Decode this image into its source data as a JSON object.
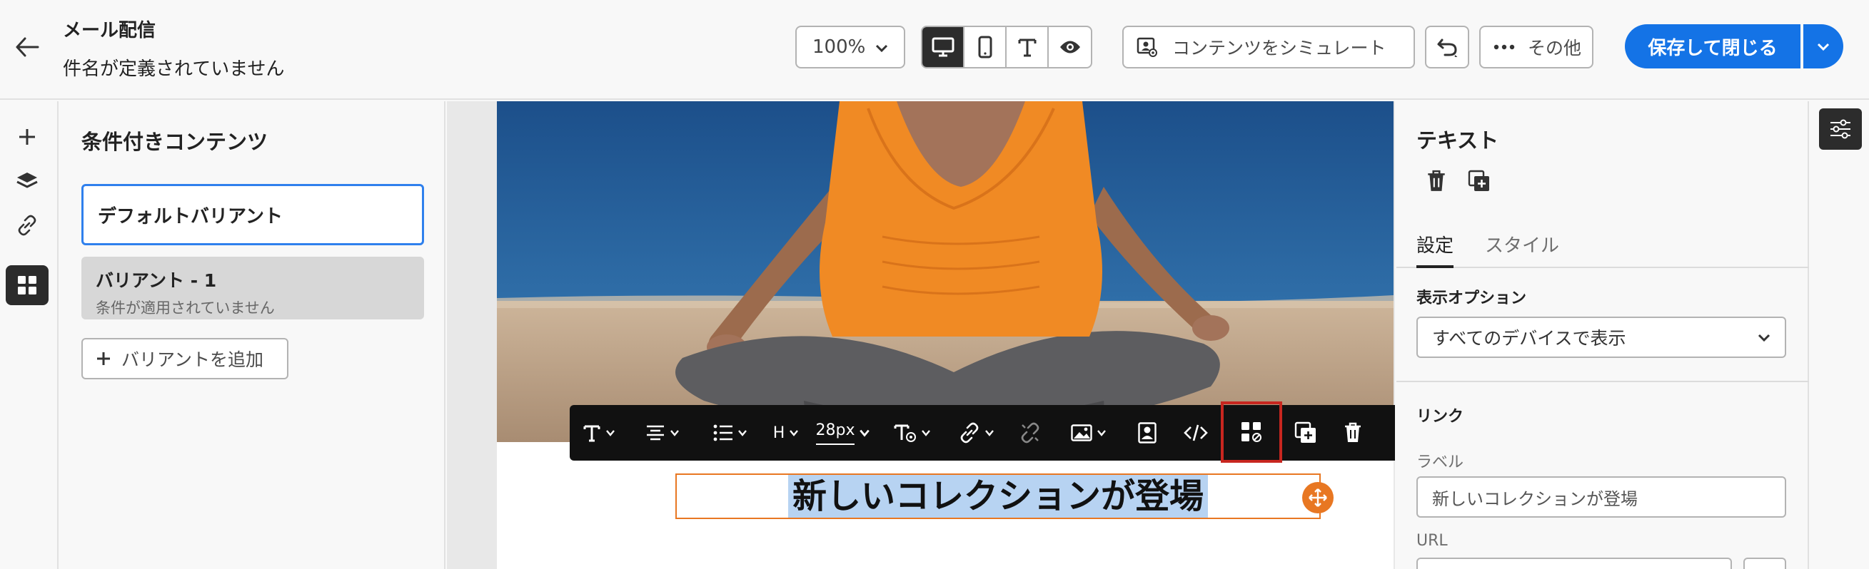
{
  "header": {
    "app_title": "メール配信",
    "subject": "件名が定義されていません",
    "zoom": "100%",
    "simulate_label": "コンテンツをシミュレート",
    "more_label": "その他",
    "save_label": "保存して閉じる"
  },
  "left_panel": {
    "title": "条件付きコンテンツ",
    "default_variant": "デフォルトバリアント",
    "variant_1_name": "バリアント - 1",
    "variant_1_status": "条件が適用されていません",
    "add_variant": "バリアントを追加"
  },
  "toolbar": {
    "heading": "H",
    "font_size": "28px"
  },
  "canvas": {
    "text_content": "新しいコレクションが登場"
  },
  "right_panel": {
    "title": "テキスト",
    "tab_settings": "設定",
    "tab_style": "スタイル",
    "display_options_label": "表示オプション",
    "display_options_value": "すべてのデバイスで表示",
    "link_label": "リンク",
    "label_label": "ラベル",
    "label_value": "新しいコレクションが登場",
    "url_label": "URL"
  },
  "colors": {
    "primary": "#1473e6",
    "selection": "#b7d3f2",
    "accent_orange": "#e87722",
    "highlight_red": "#c8261f",
    "toolbar_bg": "#111111"
  }
}
